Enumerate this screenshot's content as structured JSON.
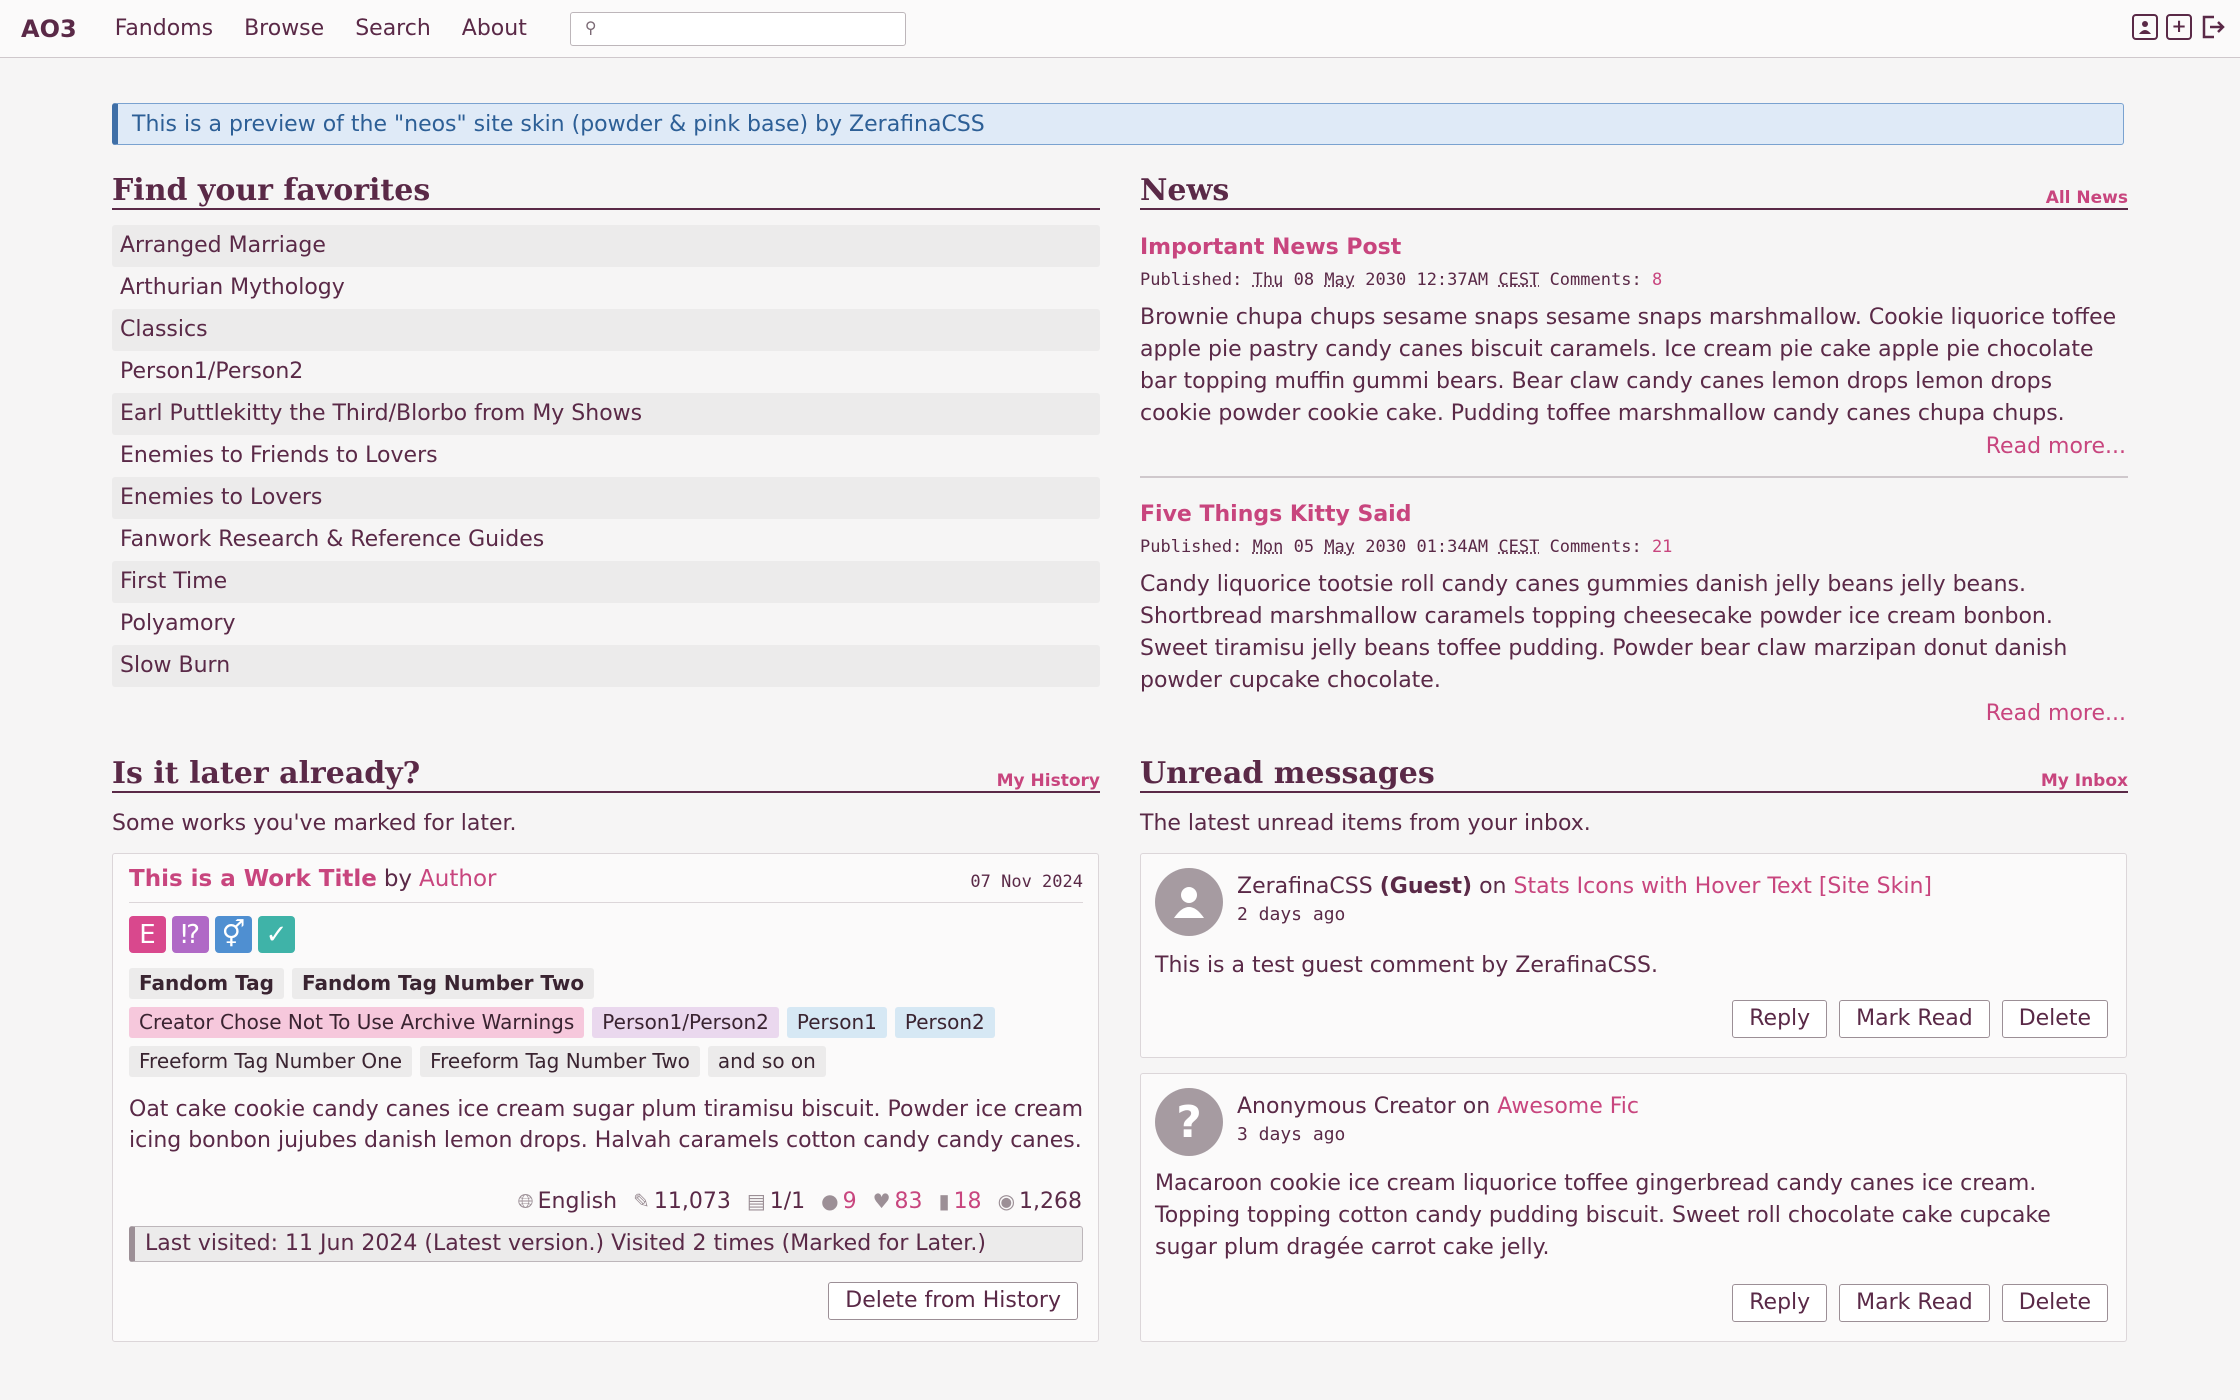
{
  "header": {
    "logo": "AO3",
    "nav": [
      "Fandoms",
      "Browse",
      "Search",
      "About"
    ],
    "search_placeholder": "",
    "icons": [
      "profile-icon",
      "post-new-icon",
      "log-out-icon"
    ]
  },
  "banner": "This is a preview of the \"neos\" site skin (powder & pink base) by ZerafinaCSS",
  "favorites": {
    "title": "Find your favorites",
    "items": [
      "Arranged Marriage",
      "Arthurian Mythology",
      "Classics",
      "Person1/Person2",
      "Earl Puttlekitty the Third/Blorbo from My Shows",
      "Enemies to Friends to Lovers",
      "Enemies to Lovers",
      "Fanwork Research & Reference Guides",
      "First Time",
      "Polyamory",
      "Slow Burn"
    ]
  },
  "news": {
    "title": "News",
    "all_link": "All News",
    "posts": [
      {
        "title": "Important News Post",
        "published_label": "Published:",
        "day": "Thu",
        "date": "08",
        "month": "May",
        "year_time": "2030 12:37AM",
        "tz": "CEST",
        "comments_label": "Comments:",
        "comments": "8",
        "body": "Brownie chupa chups sesame snaps sesame snaps marshmallow. Cookie liquorice toffee apple pie pastry candy canes biscuit caramels. Ice cream pie cake apple pie chocolate bar topping muffin gummi bears. Bear claw candy canes lemon drops lemon drops cookie powder cookie cake. Pudding toffee marshmallow candy canes chupa chups.",
        "read_more": "Read more..."
      },
      {
        "title": "Five Things Kitty Said",
        "published_label": "Published:",
        "day": "Mon",
        "date": "05",
        "month": "May",
        "year_time": "2030 01:34AM",
        "tz": "CEST",
        "comments_label": "Comments:",
        "comments": "21",
        "body": "Candy liquorice tootsie roll candy canes gummies danish jelly beans jelly beans. Shortbread marshmallow caramels topping cheesecake powder ice cream bonbon. Sweet tiramisu jelly beans toffee pudding. Powder bear claw marzipan donut danish powder cupcake chocolate.",
        "read_more": "Read more..."
      }
    ]
  },
  "later": {
    "title": "Is it later already?",
    "link": "My History",
    "subtitle": "Some works you've marked for later.",
    "work": {
      "title": "This is a Work Title",
      "by": "by",
      "author": "Author",
      "date": "07 Nov 2024",
      "required": [
        {
          "glyph": "E",
          "color": "#d9488d"
        },
        {
          "glyph": "⁉",
          "color": "#b069c6"
        },
        {
          "glyph": "⚥",
          "color": "#4f8fd1"
        },
        {
          "glyph": "✓",
          "color": "#3fb3a8"
        }
      ],
      "fandoms": [
        "Fandom Tag",
        "Fandom Tag Number Two"
      ],
      "warning": "Creator Chose Not To Use Archive Warnings",
      "relationship": "Person1/Person2",
      "characters": [
        "Person1",
        "Person2"
      ],
      "freeforms": [
        "Freeform Tag Number One",
        "Freeform Tag Number Two",
        "and so on"
      ],
      "summary": "Oat cake cookie candy canes ice cream sugar plum tiramisu biscuit. Powder ice cream icing bonbon jujubes danish lemon drops. Halvah caramels cotton candy candy canes.",
      "stats": {
        "language": "English",
        "words": "11,073",
        "chapters": "1/1",
        "comments": "9",
        "kudos": "83",
        "bookmarks": "18",
        "hits": "1,268"
      },
      "last_visited": "Last visited: 11 Jun 2024 (Latest version.) Visited 2 times (Marked for Later.)",
      "delete_label": "Delete from History"
    }
  },
  "inbox": {
    "title": "Unread messages",
    "link": "My Inbox",
    "subtitle": "The latest unread items from your inbox.",
    "messages": [
      {
        "name": "ZerafinaCSS",
        "guest": "(Guest)",
        "on": "on",
        "work": "Stats Icons with Hover Text [Site Skin]",
        "when": "2 days ago",
        "body": "This is a test guest comment by ZerafinaCSS.",
        "reply": "Reply",
        "mark_read": "Mark Read",
        "delete": "Delete"
      },
      {
        "name": "Anonymous Creator",
        "on": "on",
        "work": "Awesome Fic",
        "when": "3 days ago",
        "body": "Macaroon cookie ice cream liquorice toffee gingerbread candy canes ice cream. Topping topping cotton candy pudding biscuit. Sweet roll chocolate cake cupcake sugar plum dragée carrot cake jelly.",
        "reply": "Reply",
        "mark_read": "Mark Read",
        "delete": "Delete"
      }
    ]
  },
  "colors": {
    "text": "#5a2947",
    "accent": "#c8457e",
    "banner_bg": "#dfeaf7"
  }
}
